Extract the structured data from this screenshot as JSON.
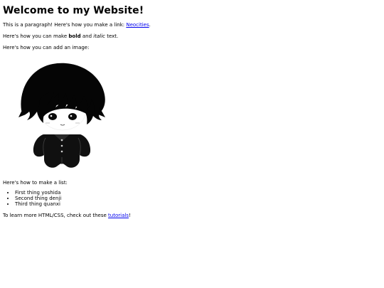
{
  "page": {
    "heading": "Welcome to my Website!",
    "paragraph_link": {
      "before": "This is a paragraph! Here's how you make a link: ",
      "link_text": "Neocities",
      "after": "."
    },
    "paragraph_format": {
      "before": "Here's how you can make ",
      "bold_text": "bold",
      "middle": " and ",
      "italic_text": "italic",
      "after": " text."
    },
    "paragraph_image": "Here's how you can add an image:",
    "paragraph_list": "Here's how to make a list:",
    "list_items": [
      "First thing yoshida",
      "Second thing denji",
      "Third thing quanxi"
    ],
    "paragraph_learn": {
      "before": "To learn more HTML/CSS, check out these ",
      "link_text": "tutorials",
      "after": "!"
    }
  },
  "colors": {
    "link": "#0000ee",
    "text": "#000000",
    "background": "#ffffff"
  }
}
